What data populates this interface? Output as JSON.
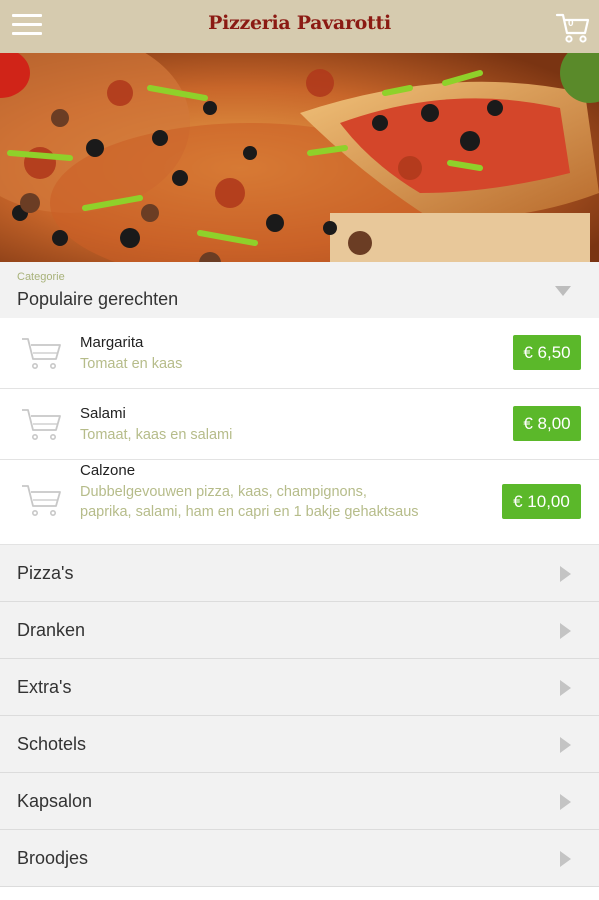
{
  "header": {
    "logo_text": "Pizzeria Pavarotti",
    "cart_count": "0",
    "menu_icon": "hamburger-icon",
    "cart_icon": "shopping-cart-icon"
  },
  "hero": {
    "image": "pizza-photo"
  },
  "category": {
    "label": "Categorie",
    "selected": "Populaire gerechten"
  },
  "products": [
    {
      "name": "Margarita",
      "description": "Tomaat en kaas",
      "price": "€ 6,50"
    },
    {
      "name": "Salami",
      "description": "Tomaat, kaas en salami",
      "price": "€ 8,00"
    },
    {
      "name": "Calzone",
      "description": "Dubbelgevouwen pizza, kaas, champignons, paprika, salami, ham en capri en 1 bakje gehaktsaus",
      "price": "€ 10,00"
    }
  ],
  "menu": [
    {
      "label": "Pizza's"
    },
    {
      "label": "Dranken"
    },
    {
      "label": "Extra's"
    },
    {
      "label": "Schotels"
    },
    {
      "label": "Kapsalon"
    },
    {
      "label": "Broodjes"
    }
  ],
  "colors": {
    "header_bg": "#d6cbaf",
    "logo": "#8b1a13",
    "price_bg": "#5bb82a",
    "description": "#b6bc8a"
  }
}
